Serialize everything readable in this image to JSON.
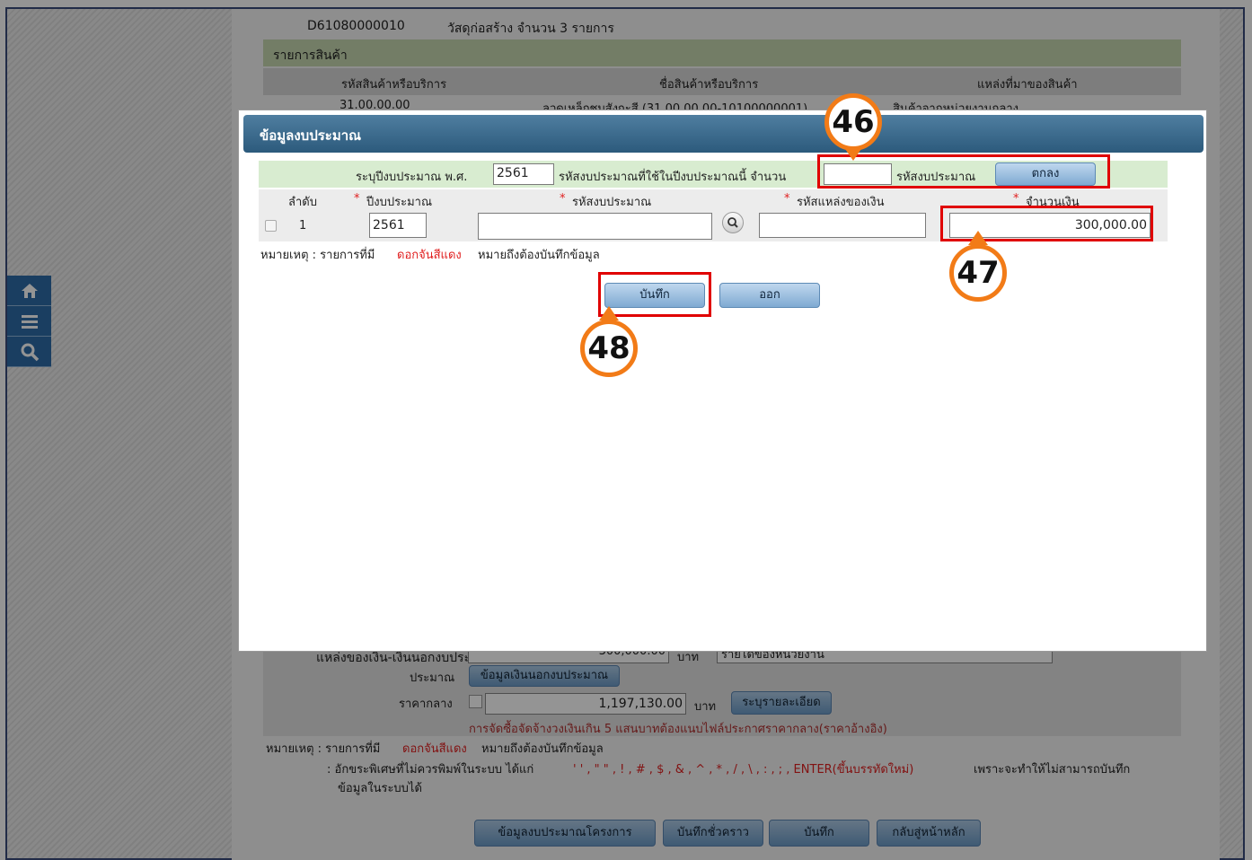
{
  "background": {
    "doc_no": "D61080000010",
    "doc_desc": "วัสดุก่อสร้าง จำนวน 3 รายการ",
    "section_title": "รายการสินค้า",
    "columns": [
      "รหัสสินค้าหรือบริการ",
      "ชื่อสินค้าหรือบริการ",
      "แหล่งที่มาของสินค้า"
    ],
    "row_code": "31.00.00.00",
    "row_name": "ลวดเหล็กชุบสังกะสี (31.00.00.00-10100000001)",
    "row_source": "สินค้าจากหน่วยงานกลาง",
    "budget_source_label": "แหล่งของเงิน-เงินนอกงบประมาณ",
    "budget_source_amount": "300,000.00",
    "budget_source_unit": "บาท",
    "budget_source_select": "รายได้ของหน่วยงาน",
    "budget_label": "ประมาณ",
    "budget_button": "ข้อมูลเงินนอกงบประมาณ",
    "median_label": "ราคากลาง",
    "median_amount": "1,197,130.00",
    "median_unit": "บาท",
    "median_button": "ระบุรายละเอียด",
    "median_note": "การจัดซื้อจัดจ้างวงเงินเกิน 5 แสนบาทต้องแนบไฟล์ประกาศราคากลาง(ราคาอ้างอิง)",
    "note_prefix": "หมายเหตุ : รายการที่มี",
    "note_red": "ดอกจันสีแดง",
    "note_suffix": "หมายถึงต้องบันทึกข้อมูล",
    "note2_prefix": ": อักขระพิเศษที่ไม่ควรพิมพ์ในระบบ ได้แก่",
    "note2_chars": "' ' , \" \" , ! , # , $ , & , ^ , * , / , \\ , : , ; , ENTER(ขึ้นบรรทัดใหม่)",
    "note2_suffix": "เพราะจะทำให้ไม่สามารถบันทึก",
    "note3": "ข้อมูลในระบบได้",
    "buttons": [
      "ข้อมูลงบประมาณโครงการ",
      "บันทึกชั่วคราว",
      "บันทึก",
      "กลับสู่หน้าหลัก"
    ]
  },
  "sidenav": {
    "icons": [
      "home-icon",
      "menu-icon",
      "search-icon"
    ]
  },
  "modal": {
    "title": "ข้อมูลงบประมาณ",
    "fiscal_year_label": "ระบุปีงบประมาณ พ.ศ.",
    "fiscal_year_value": "2561",
    "count_label": "รหัสงบประมาณที่ใช้ในปีงบประมาณนี้ จำนวน",
    "count_value": "",
    "count_suffix": "รหัสงบประมาณ",
    "ok_button": "ตกลง",
    "headers": {
      "order": "ลำดับ",
      "year": "ปีงบประมาณ",
      "budget_code": "รหัสงบประมาณ",
      "fund_code": "รหัสแหล่งของเงิน",
      "amount": "จำนวนเงิน"
    },
    "required_mark": "*",
    "row": {
      "order": "1",
      "year": "2561",
      "budget_code": "",
      "fund_code": "",
      "amount": "300,000.00"
    },
    "note_prefix": "หมายเหตุ : รายการที่มี",
    "note_red": "ดอกจันสีแดง",
    "note_suffix": "หมายถึงต้องบันทึกข้อมูล",
    "save_button": "บันทึก",
    "exit_button": "ออก"
  },
  "annotations": {
    "marker_46": "46",
    "marker_47": "47",
    "marker_48": "48"
  },
  "colors": {
    "highlight": "#e00000",
    "marker_ring": "#f27b17",
    "header_blue": "#2c5a7c"
  }
}
